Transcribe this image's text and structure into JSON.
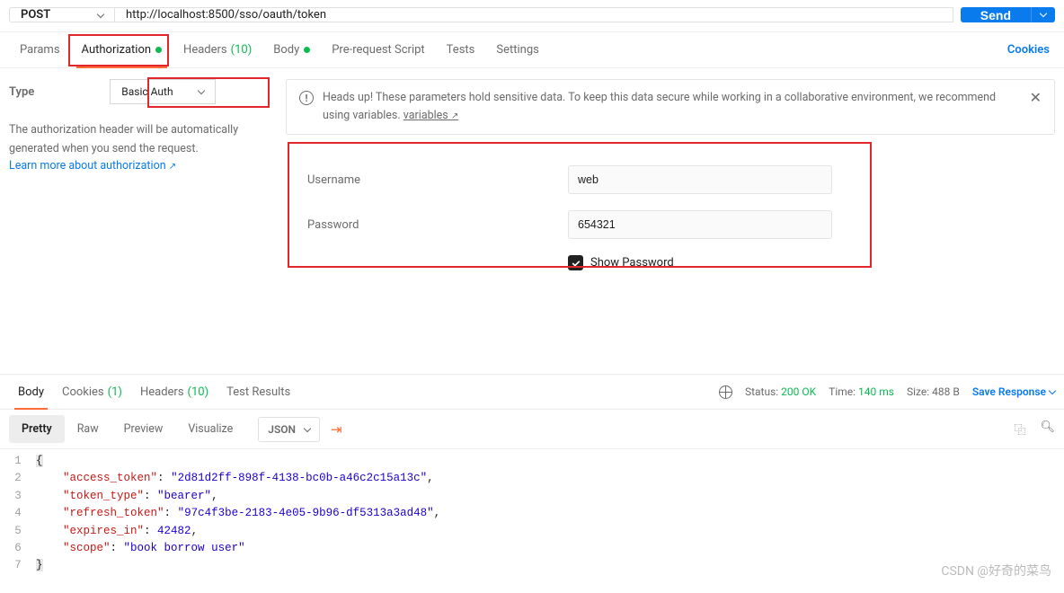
{
  "request": {
    "method": "POST",
    "url": "http://localhost:8500/sso/oauth/token",
    "send_label": "Send"
  },
  "tabs": {
    "params": "Params",
    "auth": "Authorization",
    "headers": "Headers",
    "headers_count": "(10)",
    "body": "Body",
    "prereq": "Pre-request Script",
    "tests": "Tests",
    "settings": "Settings",
    "cookies": "Cookies"
  },
  "auth": {
    "type_label": "Type",
    "type_value": "Basic Auth",
    "help_text": "The authorization header will be automatically generated when you send the request.",
    "learn_more": "Learn more about authorization",
    "banner": {
      "text_a": "Heads up! These parameters hold sensitive data. To keep this data secure while working in a collaborative environment, we recommend using variables. ",
      "vars_link": "variables"
    },
    "username_label": "Username",
    "username_value": "web",
    "password_label": "Password",
    "password_value": "654321",
    "show_password": "Show Password"
  },
  "response": {
    "tabs": {
      "body": "Body",
      "cookies": "Cookies",
      "cookies_count": "(1)",
      "headers": "Headers",
      "headers_count": "(10)",
      "tests": "Test Results"
    },
    "status_label": "Status:",
    "status_value": "200 OK",
    "time_label": "Time:",
    "time_value": "140 ms",
    "size_label": "Size:",
    "size_value": "488 B",
    "save": "Save Response",
    "views": {
      "pretty": "Pretty",
      "raw": "Raw",
      "preview": "Preview",
      "visualize": "Visualize"
    },
    "lang": "JSON",
    "json": {
      "access_token": "2d81d2ff-898f-4138-bc0b-a46c2c15a13c",
      "token_type": "bearer",
      "refresh_token": "97c4f3be-2183-4e05-9b96-df5313a3ad48",
      "expires_in": 42482,
      "scope": "book borrow user"
    }
  },
  "watermark": "CSDN @好奇的菜鸟"
}
